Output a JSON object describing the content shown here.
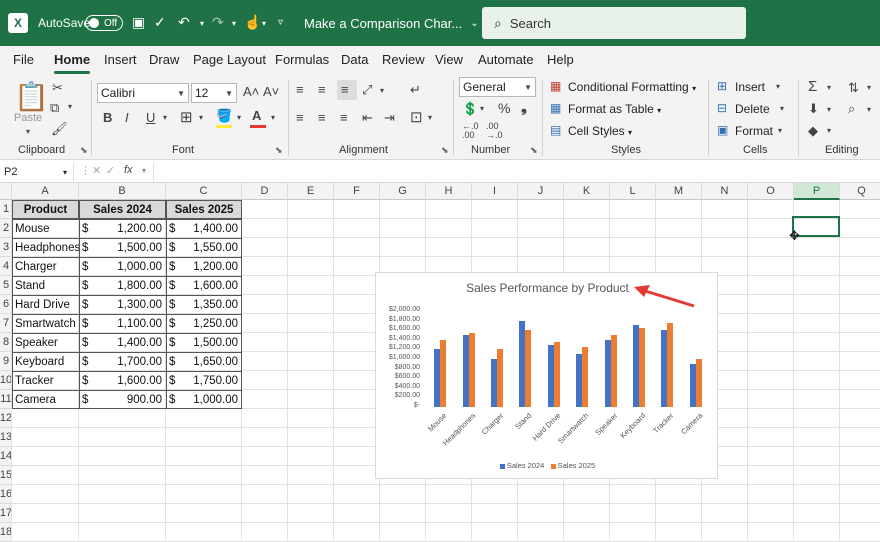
{
  "titlebar": {
    "autosave_label": "AutoSave",
    "autosave_state": "Off",
    "doc_title": "Make a Comparison Char...",
    "search_placeholder": "Search"
  },
  "menu": {
    "tabs": [
      "File",
      "Home",
      "Insert",
      "Draw",
      "Page Layout",
      "Formulas",
      "Data",
      "Review",
      "View",
      "Automate",
      "Help"
    ],
    "active": "Home"
  },
  "ribbon": {
    "clipboard": {
      "label": "Clipboard",
      "paste": "Paste"
    },
    "font": {
      "label": "Font",
      "family": "Calibri",
      "size": "12"
    },
    "alignment": {
      "label": "Alignment"
    },
    "number": {
      "label": "Number",
      "format": "General"
    },
    "styles": {
      "label": "Styles",
      "conditional": "Conditional Formatting",
      "format_table": "Format as Table",
      "cell_styles": "Cell Styles"
    },
    "cells": {
      "label": "Cells",
      "insert": "Insert",
      "delete": "Delete",
      "format": "Format"
    },
    "editing": {
      "label": "Editing"
    }
  },
  "formula_bar": {
    "name_box": "P2",
    "fx": "fx",
    "content": ""
  },
  "columns": [
    "A",
    "B",
    "C",
    "D",
    "E",
    "F",
    "G",
    "H",
    "I",
    "J",
    "K",
    "L",
    "M",
    "N",
    "O",
    "P",
    "Q"
  ],
  "selected_column": "P",
  "selected_cell": "P2",
  "rows": [
    "1",
    "2",
    "3",
    "4",
    "5",
    "6",
    "7",
    "8",
    "9",
    "10",
    "11",
    "12",
    "13",
    "14",
    "15",
    "16",
    "17",
    "18"
  ],
  "table": {
    "headers": [
      "Product",
      "Sales 2024",
      "Sales 2025"
    ],
    "rows": [
      [
        "Mouse",
        "$",
        "1,200.00",
        "$",
        "1,400.00"
      ],
      [
        "Headphones",
        "$",
        "1,500.00",
        "$",
        "1,550.00"
      ],
      [
        "Charger",
        "$",
        "1,000.00",
        "$",
        "1,200.00"
      ],
      [
        "Stand",
        "$",
        "1,800.00",
        "$",
        "1,600.00"
      ],
      [
        "Hard Drive",
        "$",
        "1,300.00",
        "$",
        "1,350.00"
      ],
      [
        "Smartwatch",
        "$",
        "1,100.00",
        "$",
        "1,250.00"
      ],
      [
        "Speaker",
        "$",
        "1,400.00",
        "$",
        "1,500.00"
      ],
      [
        "Keyboard",
        "$",
        "1,700.00",
        "$",
        "1,650.00"
      ],
      [
        "Tracker",
        "$",
        "1,600.00",
        "$",
        "1,750.00"
      ],
      [
        "Camera",
        "$",
        "900.00",
        "$",
        "1,000.00"
      ]
    ]
  },
  "chart_data": {
    "type": "bar",
    "title": "Sales Performance by Product",
    "categories": [
      "Mouse",
      "Headphones",
      "Charger",
      "Stand",
      "Hard Drive",
      "Smartwatch",
      "Speaker",
      "Keyboard",
      "Tracker",
      "Camera"
    ],
    "series": [
      {
        "name": "Sales 2024",
        "values": [
          1200,
          1500,
          1000,
          1800,
          1300,
          1100,
          1400,
          1700,
          1600,
          900
        ],
        "color": "#4472c4"
      },
      {
        "name": "Sales 2025",
        "values": [
          1400,
          1550,
          1200,
          1600,
          1350,
          1250,
          1500,
          1650,
          1750,
          1000
        ],
        "color": "#ed7d31"
      }
    ],
    "ylim": [
      0,
      2000
    ],
    "yticks": [
      "$2,000.00",
      "$1,800.00",
      "$1,600.00",
      "$1,400.00",
      "$1,200.00",
      "$1,000.00",
      "$800.00",
      "$600.00",
      "$400.00",
      "$200.00",
      "$-"
    ],
    "legend": "bottom",
    "grid": false
  },
  "annotation": {
    "arrow_color": "#e53935"
  }
}
